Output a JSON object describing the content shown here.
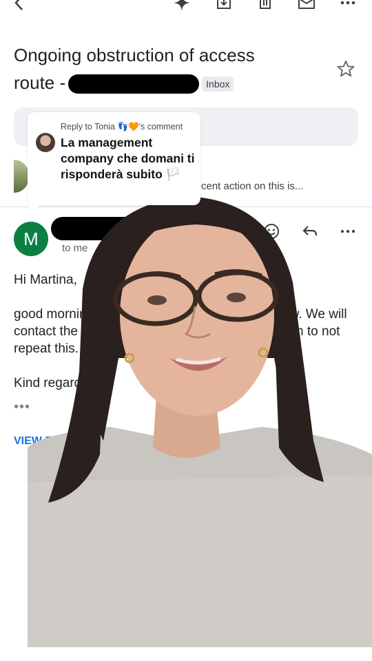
{
  "toolbar": {
    "icons": [
      "back-icon",
      "sparkle-icon",
      "archive-icon",
      "delete-icon",
      "mail-icon",
      "more-icon"
    ]
  },
  "email": {
    "subject_line1": "Ongoing obstruction of access",
    "subject_line2": "route -",
    "label_chip": "Inbox",
    "previous_snippet": "cent action on this is...",
    "to_me": "to me",
    "sender_initial": "M",
    "body": {
      "greeting": "Hi Martina,",
      "line1_left": "good morning",
      "line1_right": "ow. We will",
      "line2_left": "contact the fl",
      "line2_right": "him to not",
      "line3": "repeat this.",
      "closing": "Kind regards",
      "more": "•••",
      "view_link": "VIEW EN"
    },
    "colors": {
      "sender_avatar": "#0b8043",
      "link": "#1a73e8"
    }
  },
  "comment": {
    "meta": "Reply to Tonia 👣🧡's comment",
    "text": "La management company che domani ti risponderà subito 🏳️"
  }
}
